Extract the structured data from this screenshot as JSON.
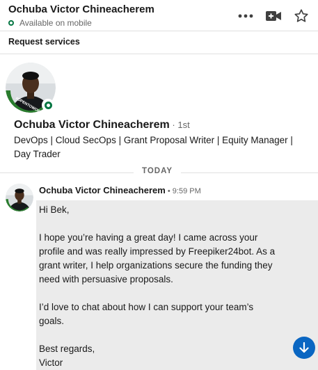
{
  "header": {
    "name": "Ochuba Victor Chineacherem",
    "status": "Available on mobile",
    "icons": [
      "more-icon",
      "video-icon",
      "star-icon"
    ]
  },
  "subbar": {
    "label": "Request services"
  },
  "profile": {
    "name": "Ochuba Victor Chineacherem",
    "degree": " · 1st",
    "headline": "DevOps | Cloud SecOps | Grant Proposal Writer | Equity Manager | Day Trader",
    "avatar_badge_text": "#OPENTOWORK"
  },
  "divider": {
    "label": "TODAY"
  },
  "message": {
    "sender": "Ochuba Victor Chineacherem",
    "time": " • 9:59 PM",
    "paragraphs": [
      "Hi Bek,",
      "I hope you’re having a great day! I came across your profile and was really impressed by Freepiker24bot. As a grant writer, I help organizations secure the funding they need with persuasive proposals.",
      "I’d love to chat about how I can support your team’s goals."
    ],
    "signoff": "Best regards,",
    "signature": "Victor"
  },
  "colors": {
    "accent": "#0a66c2",
    "online": "#057642",
    "open_to_work": "#2a7c2e",
    "message_bg": "#ebebeb"
  }
}
